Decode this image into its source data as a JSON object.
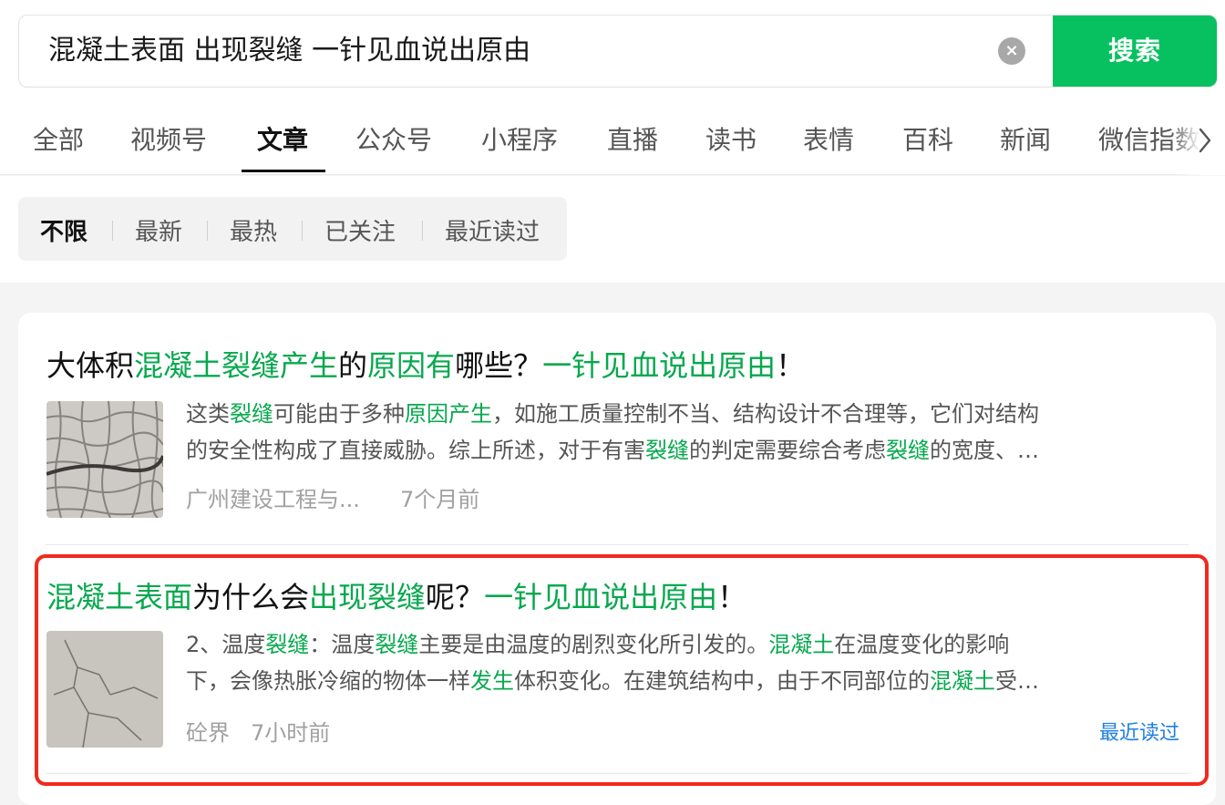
{
  "search": {
    "query": "混凝土表面 出现裂缝 一针见血说出原由",
    "clear_icon": "×",
    "button_label": "搜索"
  },
  "tabs": [
    {
      "label": "全部"
    },
    {
      "label": "视频号"
    },
    {
      "label": "文章",
      "active": true
    },
    {
      "label": "公众号"
    },
    {
      "label": "小程序"
    },
    {
      "label": "直播"
    },
    {
      "label": "读书"
    },
    {
      "label": "表情"
    },
    {
      "label": "百科"
    },
    {
      "label": "新闻"
    },
    {
      "label": "微信指数"
    }
  ],
  "filters": [
    {
      "label": "不限",
      "active": true
    },
    {
      "label": "最新"
    },
    {
      "label": "最热"
    },
    {
      "label": "已关注"
    },
    {
      "label": "最近读过"
    }
  ],
  "results": [
    {
      "title": [
        {
          "text": "大体积",
          "hl": false
        },
        {
          "text": "混凝土裂缝产生",
          "hl": true
        },
        {
          "text": "的",
          "hl": false
        },
        {
          "text": "原因有",
          "hl": true
        },
        {
          "text": "哪些？",
          "hl": false
        },
        {
          "text": "一针见血说出原由",
          "hl": true
        },
        {
          "text": "！",
          "hl": false
        }
      ],
      "snippet_lines": [
        [
          {
            "text": "这类",
            "hl": false
          },
          {
            "text": "裂缝",
            "hl": true
          },
          {
            "text": "可能由于多种",
            "hl": false
          },
          {
            "text": "原因产生",
            "hl": true
          },
          {
            "text": "，如施工质量控制不当、结构设计不合理等，它们对结构",
            "hl": false
          }
        ],
        [
          {
            "text": "的安全性构成了直接威胁。综上所述，对于有害",
            "hl": false
          },
          {
            "text": "裂缝",
            "hl": true
          },
          {
            "text": "的判定需要综合考虑",
            "hl": false
          },
          {
            "text": "裂缝",
            "hl": true
          },
          {
            "text": "的宽度、…",
            "hl": false
          }
        ]
      ],
      "source": "广州建设工程与...",
      "time": "7个月前",
      "thumbnail_icon": "cracked-pavement-image"
    },
    {
      "title": [
        {
          "text": "混凝土表面",
          "hl": true
        },
        {
          "text": "为什么会",
          "hl": false
        },
        {
          "text": "出现裂缝",
          "hl": true
        },
        {
          "text": "呢？",
          "hl": false
        },
        {
          "text": "一针见血说出原由",
          "hl": true
        },
        {
          "text": "！",
          "hl": false
        }
      ],
      "snippet_lines": [
        [
          {
            "text": "2、温度",
            "hl": false
          },
          {
            "text": "裂缝",
            "hl": true
          },
          {
            "text": "：温度",
            "hl": false
          },
          {
            "text": "裂缝",
            "hl": true
          },
          {
            "text": "主要是由温度的剧烈变化所引发的。",
            "hl": false
          },
          {
            "text": "混凝土",
            "hl": true
          },
          {
            "text": "在温度变化的影响",
            "hl": false
          }
        ],
        [
          {
            "text": "下，会像热胀冷缩的物体一样",
            "hl": false
          },
          {
            "text": "发生",
            "hl": true
          },
          {
            "text": "体积变化。在建筑结构中，由于不同部位的",
            "hl": false
          },
          {
            "text": "混凝土",
            "hl": true
          },
          {
            "text": "受…",
            "hl": false
          }
        ]
      ],
      "source": "砼界",
      "time": "7小时前",
      "recent_tag": "最近读过",
      "thumbnail_icon": "cracked-concrete-image"
    }
  ],
  "colors": {
    "accent_green": "#07c160",
    "highlight_green": "#07a84e",
    "recent_blue": "#1f7fe0",
    "outline_red": "#f02a1d"
  }
}
